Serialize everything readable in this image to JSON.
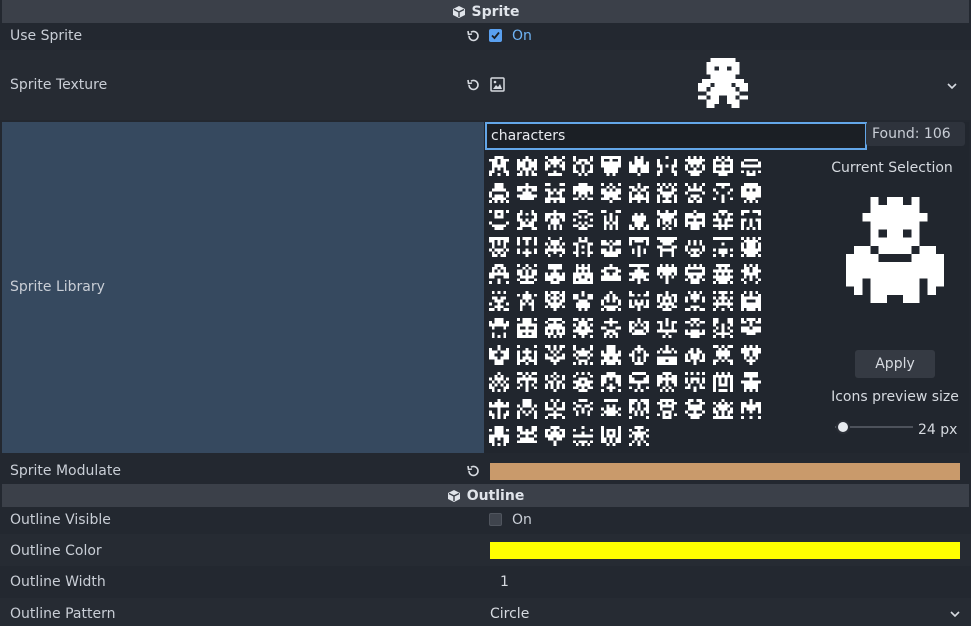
{
  "sprite_section": {
    "title": "Sprite",
    "icon": "cube-icon"
  },
  "use_sprite": {
    "label": "Use Sprite",
    "checked": true,
    "value_text": "On"
  },
  "sprite_texture": {
    "label": "Sprite Texture"
  },
  "sprite_library": {
    "label": "Sprite Library",
    "search_value": "characters",
    "found_text": "Found: 106",
    "grid_count": 106,
    "current_selection_label": "Current Selection",
    "apply_label": "Apply",
    "preview_size_label": "Icons preview size",
    "preview_size_value": "24 px"
  },
  "sprite_modulate": {
    "label": "Sprite Modulate",
    "color": "#c99a6b"
  },
  "outline_section": {
    "title": "Outline",
    "icon": "cube-icon"
  },
  "outline_visible": {
    "label": "Outline Visible",
    "checked": false,
    "value_text": "On"
  },
  "outline_color": {
    "label": "Outline Color",
    "color": "#ffff00"
  },
  "outline_width": {
    "label": "Outline Width",
    "value": "1"
  },
  "outline_pattern": {
    "label": "Outline Pattern",
    "value": "Circle"
  }
}
